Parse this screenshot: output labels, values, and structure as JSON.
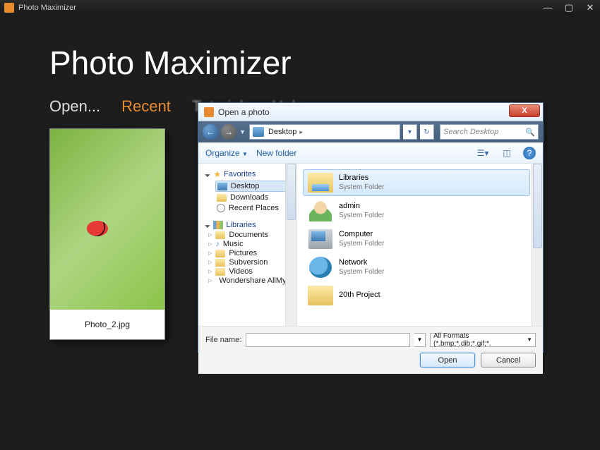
{
  "app": {
    "window_title": "Photo Maximizer",
    "heading": "Photo Maximizer",
    "nav": {
      "open": "Open...",
      "recent": "Recent",
      "tutorials": "Tutorials",
      "help": "Help"
    }
  },
  "thumb": {
    "filename": "Photo_2.jpg"
  },
  "dialog": {
    "title": "Open a photo",
    "address": "Desktop",
    "search_placeholder": "Search Desktop",
    "toolbar": {
      "organize": "Organize",
      "newfolder": "New folder"
    },
    "tree": {
      "favorites": {
        "label": "Favorites",
        "items": [
          "Desktop",
          "Downloads",
          "Recent Places"
        ]
      },
      "libraries": {
        "label": "Libraries",
        "items": [
          "Documents",
          "Music",
          "Pictures",
          "Subversion",
          "Videos",
          "Wondershare AllMyTube"
        ]
      }
    },
    "files": [
      {
        "name": "Libraries",
        "sub": "System Folder",
        "icon": "lib",
        "selected": true
      },
      {
        "name": "admin",
        "sub": "System Folder",
        "icon": "user",
        "selected": false
      },
      {
        "name": "Computer",
        "sub": "System Folder",
        "icon": "comp",
        "selected": false
      },
      {
        "name": "Network",
        "sub": "System Folder",
        "icon": "net",
        "selected": false
      },
      {
        "name": "20th Project",
        "sub": "",
        "icon": "fold",
        "selected": false
      }
    ],
    "filename_label": "File name:",
    "filter": "All Formats (*.bmp;*.dib;*.gif;*.",
    "open_btn": "Open",
    "cancel_btn": "Cancel"
  }
}
